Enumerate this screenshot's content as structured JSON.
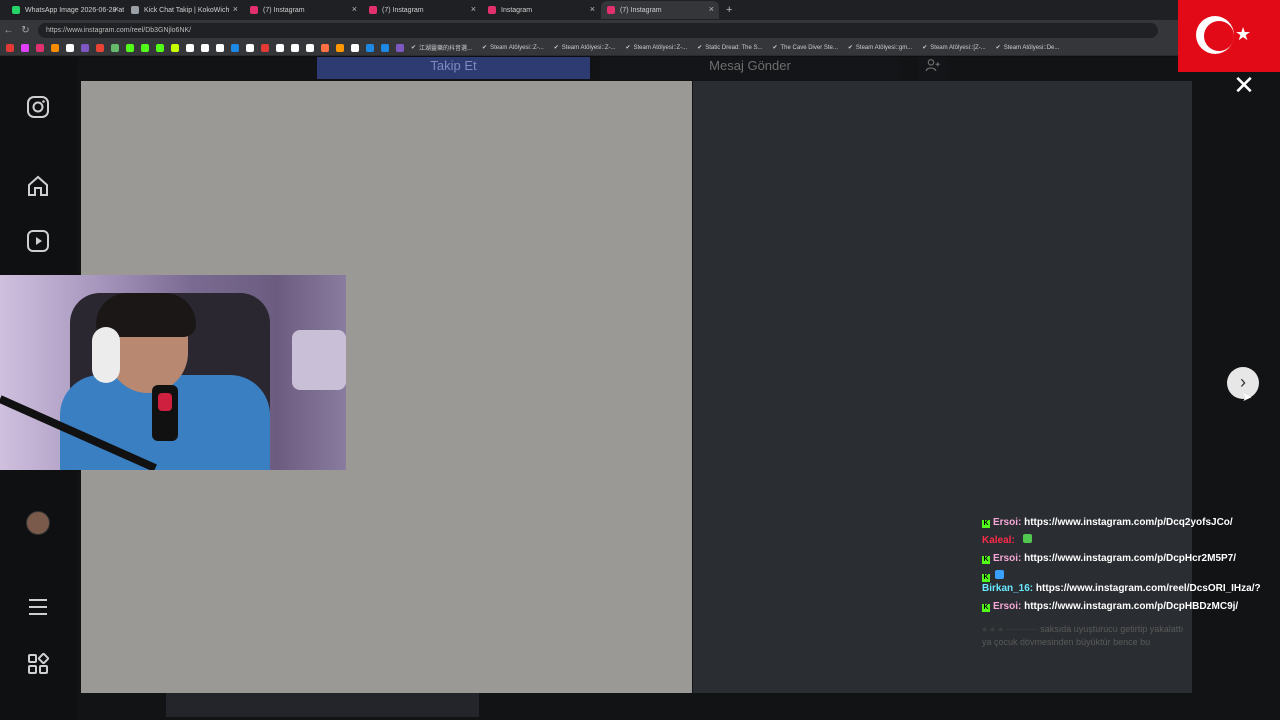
{
  "browser": {
    "tabs": [
      {
        "title": "WhatsApp Image 2026-06-28 at 0",
        "fav_color": "#25d366",
        "active": false
      },
      {
        "title": "Kick Chat Takip | KokoWich",
        "fav_color": "#9aa0a6",
        "active": false
      },
      {
        "title": "(7) Instagram",
        "fav_color": "#e1306c",
        "active": false
      },
      {
        "title": "(7) Instagram",
        "fav_color": "#e1306c",
        "active": false
      },
      {
        "title": "Instagram",
        "fav_color": "#e1306c",
        "active": false
      },
      {
        "title": "(7) Instagram",
        "fav_color": "#e1306c",
        "active": true
      }
    ],
    "new_tab": "+",
    "url": "https://www.instagram.com/reel/Db3GNjlo6NK/",
    "bookmarks": [
      "江湖靈樂的抖音選...",
      "Steam Atölyesi::Z-...",
      "Steam Atölyesi::Z-...",
      "Steam Atölyesi::Z-...",
      "Static Dread: The S...",
      "The Cave Diver Ste...",
      "Steam Atölyesi::gm...",
      "Steam Atölyesi::[Z-...",
      "Steam Atölyesi::De..."
    ],
    "bookmark_icon_colors": [
      "#e53935",
      "#e040fb",
      "#e1306c",
      "#fb8c00",
      "#ffffff",
      "#7e57c2",
      "#ea4335",
      "#66bb6a",
      "#53fc18",
      "#53fc18",
      "#53fc18",
      "#c6ff00",
      "#ffffff",
      "#ffffff",
      "#ffffff",
      "#1e88e5",
      "#ffffff",
      "#e53935",
      "#ffffff",
      "#ffffff",
      "#ffffff",
      "#ff7043",
      "#ff9800",
      "#ffffff",
      "#1e88e5",
      "#1e88e5",
      "#7e57c2"
    ]
  },
  "instagram": {
    "follow_label": "Takip Et",
    "message_label": "Mesaj Gönder",
    "close_icon": "✕",
    "next_icon": "›"
  },
  "chat": {
    "messages": [
      {
        "user": "Ersoi:",
        "text": " https://www.instagram.com/p/Dcq2yofsJCo/",
        "color": "#f7a8d8",
        "kick": true
      },
      {
        "user": "Kaleal:",
        "text": "",
        "color": "#ff2a4a",
        "kick": false,
        "emote": true
      },
      {
        "user": "Ersoi:",
        "text": " https://www.instagram.com/p/DcpHcr2M5P7/",
        "color": "#f7a8d8",
        "kick": true
      },
      {
        "user": "Birkan_16:",
        "text": " https://www.instagram.com/reel/DcsORI_IHza/?",
        "color": "#6ae8ff",
        "kick": false
      },
      {
        "user": "Ersoi:",
        "text": " https://www.instagram.com/p/DcpHBDzMC9j/",
        "color": "#f7a8d8",
        "kick": true
      }
    ],
    "faded_1": "saksıda uyuşturucu getirtip yakalattı",
    "faded_2": "ya çocuk dövmesinden büyüktür bence bu"
  }
}
